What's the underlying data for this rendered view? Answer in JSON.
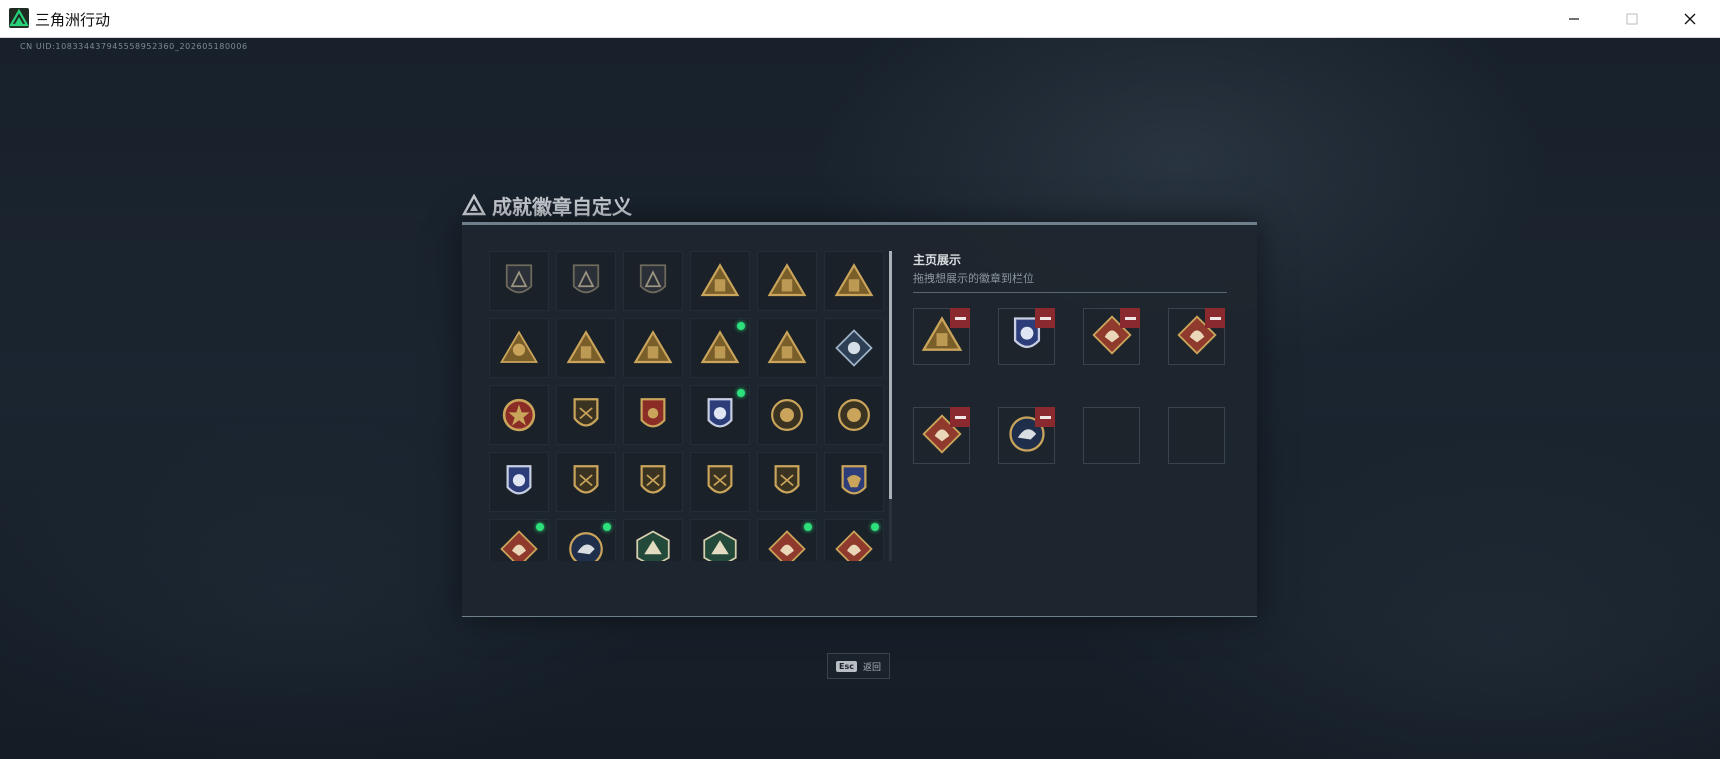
{
  "window": {
    "title": "三角洲行动",
    "buttons": {
      "minimize": "minimize-icon",
      "maximize": "maximize-icon",
      "close": "close-icon"
    }
  },
  "uid": "CN UID:1083344379455589523​60_202605180006",
  "dialog": {
    "title": "成就徽章自定义",
    "badges": [
      {
        "icon": "delta-triangle-badge-icon",
        "style": "shield-gray",
        "new": false
      },
      {
        "icon": "helicopter-badge-icon",
        "style": "shield-gray",
        "new": false
      },
      {
        "icon": "arrow-crest-badge-icon",
        "style": "shield-gray",
        "new": false
      },
      {
        "icon": "triangle-gold-crate-icon",
        "style": "triangle-gold",
        "new": false
      },
      {
        "icon": "triangle-gold-vehicle-icon",
        "style": "triangle-gold",
        "new": false
      },
      {
        "icon": "triangle-gold-box-icon",
        "style": "triangle-gold",
        "new": false
      },
      {
        "icon": "gold-soldier-badge-icon",
        "style": "gold-emblem",
        "new": false
      },
      {
        "icon": "triangle-gold-dome-icon",
        "style": "triangle-gold",
        "new": false
      },
      {
        "icon": "triangle-gold-number-one-icon",
        "style": "triangle-gold",
        "new": false
      },
      {
        "icon": "triangle-gold-tower-icon",
        "style": "triangle-gold",
        "new": true
      },
      {
        "icon": "triangle-gold-beast-icon",
        "style": "triangle-gold",
        "new": false
      },
      {
        "icon": "silver-diamond-rose-icon",
        "style": "diamond-silver",
        "new": false
      },
      {
        "icon": "gold-star-medal-icon",
        "style": "round-gold-red",
        "new": false
      },
      {
        "icon": "gold-shield-crest-icon",
        "style": "shield-gold",
        "new": false
      },
      {
        "icon": "red-gold-shield-icon",
        "style": "shield-red",
        "new": false
      },
      {
        "icon": "blue-eagle-shield-icon",
        "style": "shield-blue",
        "new": true
      },
      {
        "icon": "gold-skull-medal-icon",
        "style": "round-gold",
        "new": false
      },
      {
        "icon": "gold-sun-medal-icon",
        "style": "round-gold",
        "new": false
      },
      {
        "icon": "blue-wings-shield-icon",
        "style": "shield-blue",
        "new": false
      },
      {
        "icon": "gold-rifle-shield-icon",
        "style": "shield-gold",
        "new": false
      },
      {
        "icon": "gold-sniper-shield-icon",
        "style": "shield-gold",
        "new": false
      },
      {
        "icon": "gold-knife-shield-icon",
        "style": "shield-gold",
        "new": false
      },
      {
        "icon": "gold-pistol-shield-icon",
        "style": "shield-gold",
        "new": false
      },
      {
        "icon": "gold-blue-eagle-crest-icon",
        "style": "shield-goldblue",
        "new": false
      },
      {
        "icon": "red-diamond-wolf-icon",
        "style": "diamond-red",
        "new": true
      },
      {
        "icon": "blue-round-wolf-icon",
        "style": "round-blue",
        "new": true
      },
      {
        "icon": "green-hex-eagle-icon",
        "style": "hex-green",
        "new": false
      },
      {
        "icon": "green-hex-jet-icon",
        "style": "hex-green",
        "new": false
      },
      {
        "icon": "red-diamond-dragon-icon",
        "style": "diamond-red",
        "new": true
      },
      {
        "icon": "red-diamond-dragon-icon",
        "style": "diamond-red",
        "new": true
      }
    ],
    "showcase": {
      "title": "主页展示",
      "subtitle": "拖拽想展示的徽章到栏位",
      "slots": [
        {
          "icon": "triangle-gold-tower-icon",
          "style": "triangle-gold",
          "filled": true
        },
        {
          "icon": "blue-eagle-shield-icon",
          "style": "shield-blue",
          "filled": true
        },
        {
          "icon": "red-diamond-dragon-icon",
          "style": "diamond-red",
          "filled": true
        },
        {
          "icon": "red-diamond-dragon-icon",
          "style": "diamond-red",
          "filled": true
        },
        {
          "icon": "red-diamond-wolf-icon",
          "style": "diamond-red",
          "filled": true
        },
        {
          "icon": "blue-round-wolf-icon",
          "style": "round-blue",
          "filled": true
        },
        {
          "icon": "",
          "style": "",
          "filled": false
        },
        {
          "icon": "",
          "style": "",
          "filled": false
        }
      ],
      "remove_icon": "minus-icon"
    }
  },
  "footer": {
    "key": "Esc",
    "label": "返回"
  },
  "colors": {
    "gold": "#c9a45a",
    "new_dot": "#2ee07c",
    "remove": "#8a2a2e",
    "accent_green": "#1dbf73"
  }
}
